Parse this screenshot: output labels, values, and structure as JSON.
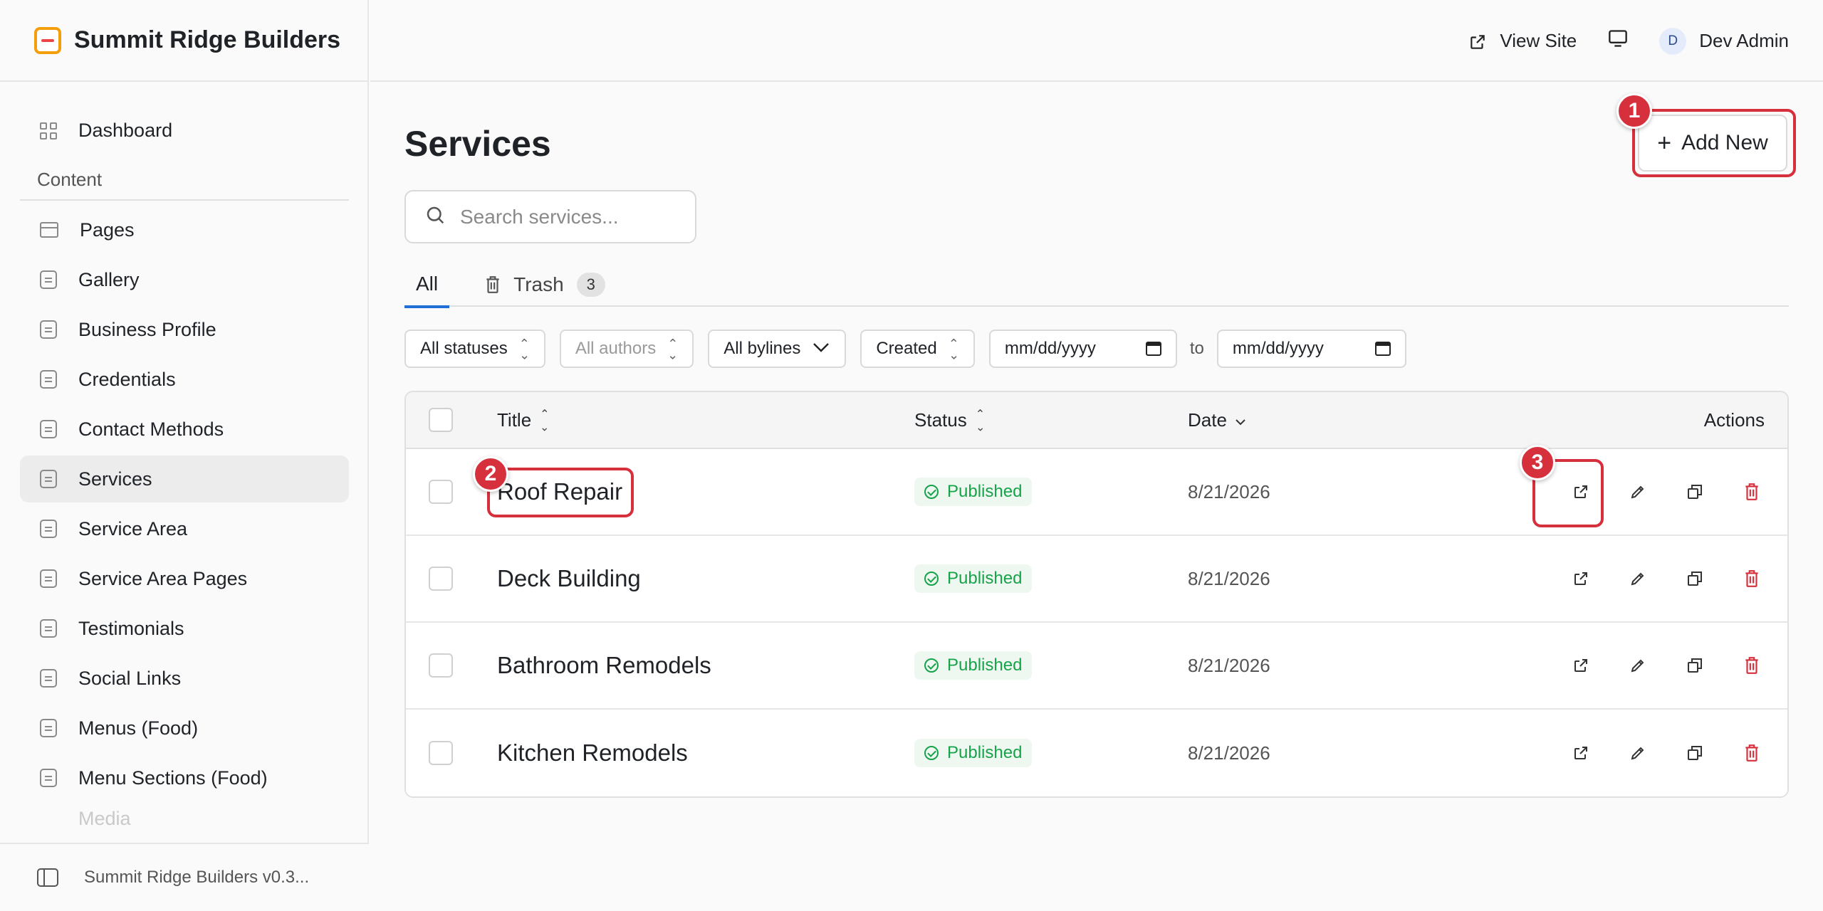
{
  "brand": {
    "name": "Summit Ridge Builders"
  },
  "header": {
    "view_site": "View Site",
    "user_initial": "D",
    "user_name": "Dev Admin"
  },
  "sidebar": {
    "dashboard": "Dashboard",
    "section_content": "Content",
    "items": [
      {
        "label": "Pages",
        "icon": "page-icon"
      },
      {
        "label": "Gallery",
        "icon": "document-icon"
      },
      {
        "label": "Business Profile",
        "icon": "document-icon"
      },
      {
        "label": "Credentials",
        "icon": "document-icon"
      },
      {
        "label": "Contact Methods",
        "icon": "document-icon"
      },
      {
        "label": "Services",
        "icon": "document-icon",
        "active": true
      },
      {
        "label": "Service Area",
        "icon": "document-icon"
      },
      {
        "label": "Service Area Pages",
        "icon": "document-icon"
      },
      {
        "label": "Testimonials",
        "icon": "document-icon"
      },
      {
        "label": "Social Links",
        "icon": "document-icon"
      },
      {
        "label": "Menus (Food)",
        "icon": "document-icon"
      },
      {
        "label": "Menu Sections (Food)",
        "icon": "document-icon"
      }
    ],
    "faded_item": "Media",
    "footer": "Summit Ridge Builders v0.3..."
  },
  "main": {
    "title": "Services",
    "add_new": "Add New",
    "search_placeholder": "Search services...",
    "tabs": {
      "all": "All",
      "trash": "Trash",
      "trash_count": "3"
    },
    "filters": {
      "statuses": "All statuses",
      "authors": "All authors",
      "bylines": "All bylines",
      "created": "Created",
      "date_from": "mm/dd/yyyy",
      "to": "to",
      "date_to": "mm/dd/yyyy"
    },
    "table": {
      "headers": {
        "title": "Title",
        "status": "Status",
        "date": "Date",
        "actions": "Actions"
      },
      "rows": [
        {
          "title": "Roof Repair",
          "status": "Published",
          "date": "8/21/2026"
        },
        {
          "title": "Deck Building",
          "status": "Published",
          "date": "8/21/2026"
        },
        {
          "title": "Bathroom Remodels",
          "status": "Published",
          "date": "8/21/2026"
        },
        {
          "title": "Kitchen Remodels",
          "status": "Published",
          "date": "8/21/2026"
        }
      ]
    }
  },
  "annotations": [
    "1",
    "2",
    "3"
  ],
  "colors": {
    "accent": "#1f6fd6",
    "published": "#16a34a",
    "danger": "#d6303c",
    "annotation": "#d6303c"
  }
}
